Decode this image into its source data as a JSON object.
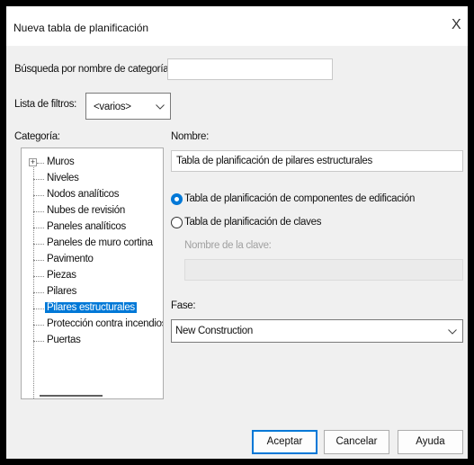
{
  "window": {
    "title": "Nueva tabla de planificación",
    "close_glyph": "X"
  },
  "search": {
    "label": "Búsqueda por nombre de categoría:",
    "value": ""
  },
  "filter": {
    "label": "Lista de filtros:",
    "value": "<varios>"
  },
  "category": {
    "label": "Categoría:",
    "items": [
      {
        "label": "Muros",
        "expandable": true
      },
      {
        "label": "Niveles"
      },
      {
        "label": "Nodos analíticos"
      },
      {
        "label": "Nubes de revisión"
      },
      {
        "label": "Paneles analíticos"
      },
      {
        "label": "Paneles de muro cortina"
      },
      {
        "label": "Pavimento"
      },
      {
        "label": "Piezas"
      },
      {
        "label": "Pilares"
      },
      {
        "label": "Pilares estructurales",
        "selected": true
      },
      {
        "label": "Protección contra incendios"
      },
      {
        "label": "Puertas"
      }
    ]
  },
  "name": {
    "label": "Nombre:",
    "value": "Tabla de planificación de pilares estructurales"
  },
  "options": {
    "radio_components": "Tabla de planificación de componentes de edificación",
    "radio_keys": "Tabla de planificación de claves",
    "key_name_label": "Nombre de la clave:",
    "selected": "components"
  },
  "phase": {
    "label": "Fase:",
    "value": "New Construction"
  },
  "buttons": {
    "accept": "Aceptar",
    "cancel": "Cancelar",
    "help": "Ayuda"
  },
  "colors": {
    "accent": "#0078d7",
    "disabled_text": "#a0a0a0"
  }
}
